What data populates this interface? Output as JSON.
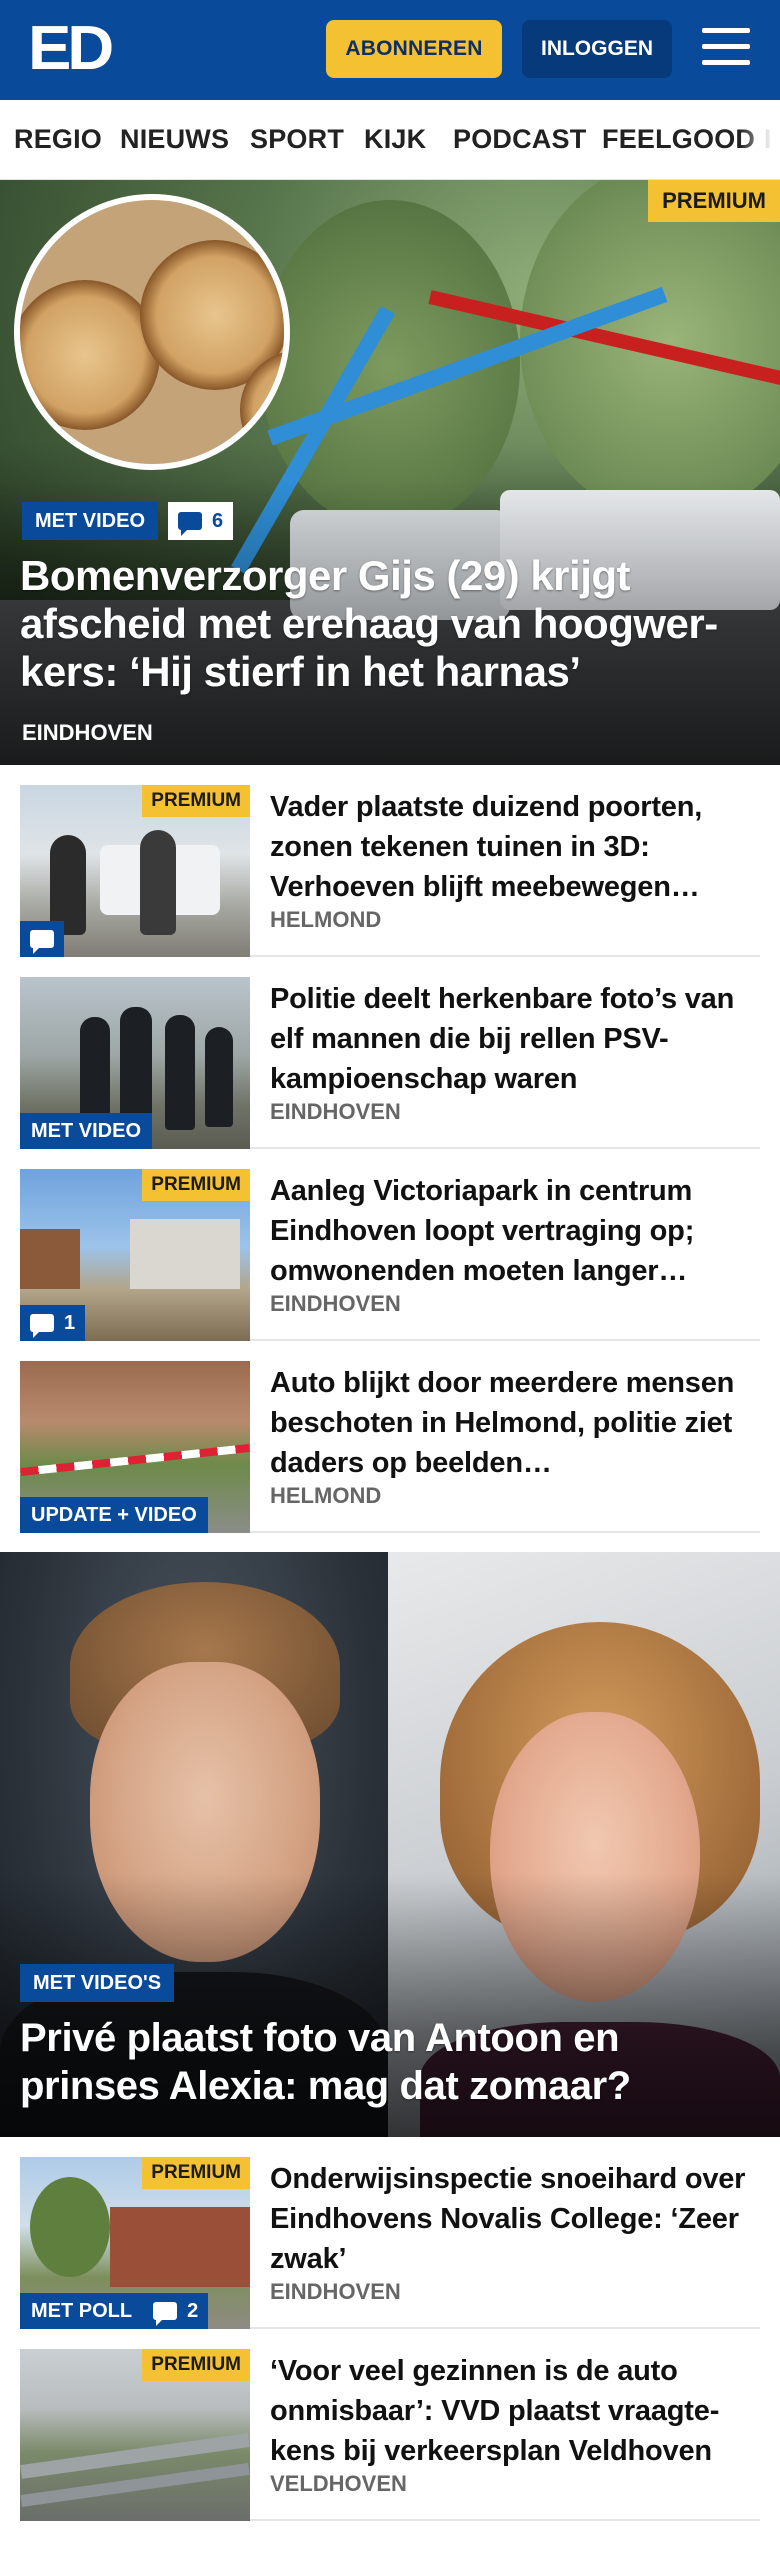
{
  "header": {
    "logo": "ED",
    "subscribe_label": "ABONNEREN",
    "login_label": "INLOGGEN"
  },
  "nav": {
    "items": [
      "REGIO",
      "NIEUWS",
      "SPORT",
      "KIJK",
      "PODCAST",
      "FEELGOOD",
      "I"
    ]
  },
  "hero": {
    "badge": "PREMIUM",
    "tag": "MET VIDEO",
    "comments": "6",
    "title": "Bomenverzorger Gijs (29) krijgt afscheid met erehaag van hoogwer­kers: ‘Hij stierf in het harnas’",
    "place": "EINDHOVEN"
  },
  "articles": [
    {
      "title": "Vader plaatste duizend poorten, zonen tekenen tuinen in 3D: Verhoeven blijft meebewegen…",
      "place": "HELMOND",
      "premium": "PREMIUM",
      "tag": "",
      "comments": ""
    },
    {
      "title": "Politie deelt herkenbare foto’s van elf mannen die bij rellen PSV-kampioenschap waren",
      "place": "EINDHOVEN",
      "premium": "",
      "tag": "MET VIDEO",
      "comments": ""
    },
    {
      "title": "Aanleg Victoriapark in centrum Eindhoven loopt vertraging op; omwonenden moeten langer…",
      "place": "EINDHOVEN",
      "premium": "PREMIUM",
      "tag": "",
      "comments": "1"
    },
    {
      "title": "Auto blijkt door meerdere mensen beschoten in Helmond, politie ziet daders op beelden…",
      "place": "HELMOND",
      "premium": "",
      "tag": "UPDATE + VIDEO",
      "comments": ""
    }
  ],
  "feature": {
    "tag": "MET VIDEO'S",
    "title": "Privé plaatst foto van Antoon en prinses Alexia: mag dat zomaar?"
  },
  "articles2": [
    {
      "title": "Onderwijsinspectie snoeihard over Eindhovens Novalis College: ‘Zeer zwak’",
      "place": "EINDHOVEN",
      "premium": "PREMIUM",
      "tag": "MET POLL",
      "comments": "2"
    },
    {
      "title": "‘Voor veel gezinnen is de auto onmisbaar’: VVD plaatst vraagte­kens bij verkeersplan Veldhoven",
      "place": "VELDHOVEN",
      "premium": "PREMIUM",
      "tag": "",
      "comments": ""
    }
  ],
  "colors": {
    "brand_blue": "#0a4a9a",
    "premium_yellow": "#f4c132"
  }
}
